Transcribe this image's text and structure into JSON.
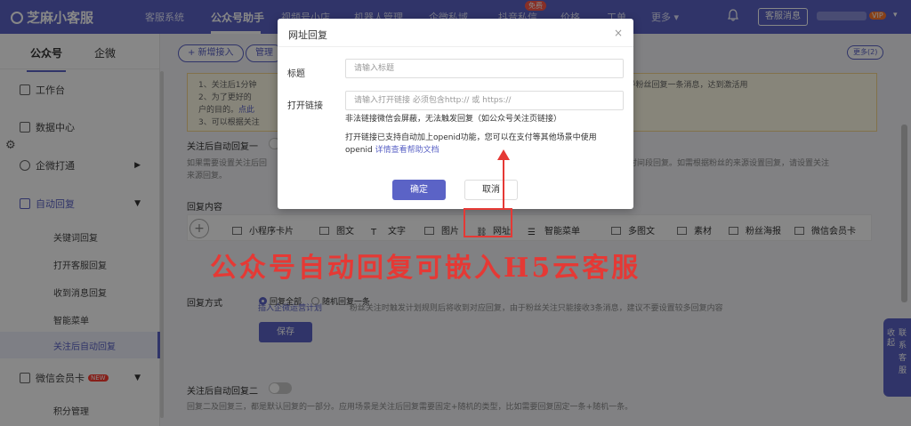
{
  "app": {
    "name": "芝麻小客服"
  },
  "topnav": {
    "items": [
      "客服系统",
      "公众号助手",
      "视频号小店",
      "机器人管理",
      "企微私域",
      "抖音私信",
      "价格",
      "工单",
      "更多"
    ],
    "active": "公众号助手",
    "free_badge": "免费",
    "kf_message_btn": "客服消息",
    "vip_badge": "VIP"
  },
  "sidebar": {
    "tabs": [
      "公众号",
      "企微"
    ],
    "items": {
      "workbench": "工作台",
      "data_center": "数据中心",
      "wecom_link": "企微打通",
      "auto_reply": "自动回复",
      "keyword_reply": "关键词回复",
      "open_kf_reply": "打开客服回复",
      "received_reply": "收到消息回复",
      "smart_menu": "智能菜单",
      "follow_reply": "关注后自动回复",
      "member_card": "微信会员卡",
      "new_badge": "NEW",
      "points": "积分管理"
    }
  },
  "content": {
    "new_access_btn": "+ 新增接入",
    "manage_btn": "管理",
    "more_btn": "更多(2)",
    "notice": {
      "line1": "1、关注后1分钟",
      "line1_tail": "会话的粉丝发送一条消息，引导粉丝回复一条消息，达到激活用",
      "line2": "2、为了更好的",
      "line2b": "户的目的。",
      "line2c": "点此",
      "line3": "3、可以根据关注"
    },
    "follow1_label": "关注后自动回复一",
    "follow1_desc1_a": "如果需要设置关注后回",
    "follow1_desc1_b": "设置按时间段回复。如需根据粉丝的来源设置回复，请设置关注",
    "follow1_desc2": "来源回复。",
    "reply_content_label": "回复内容",
    "toolbar": [
      "小程序卡片",
      "图文",
      "文字",
      "图片",
      "网址",
      "智能菜单",
      "多图文",
      "素材",
      "粉丝海报",
      "微信会员卡"
    ],
    "hint_link": "插入企微运营计划",
    "hint_text": "粉丝关注时触发计划规则后将收到对应回复，由于粉丝关注只能接收3条消息，建议不要设置较多回复内容",
    "reply_mode_label": "回复方式",
    "reply_mode_options": [
      "回复全部",
      "随机回复一条"
    ],
    "save_btn": "保存",
    "follow2_label": "关注后自动回复二",
    "follow2_desc": "回复二及回复三，都是默认回复的一部分。应用场景是关注后回复需要固定+随机的类型，比如需要回复固定一条+随机一条。"
  },
  "float_cs": {
    "text": "联系客服",
    "collapse": "收起"
  },
  "modal": {
    "title": "网址回复",
    "close": "×",
    "title_label": "标题",
    "title_placeholder": "请输入标题",
    "link_label": "打开链接",
    "link_placeholder": "请输入打开链接 必须包含http:// 或 https://",
    "note1": "非法链接微信会屏蔽，无法触发回复（如公众号关注页链接）",
    "note2": "打开链接已支持自动加上openid功能，您可以在支付等其他场景中使用",
    "note3": "openid",
    "help_link": "详情查看帮助文档",
    "ok_btn": "确定",
    "cancel_btn": "取消"
  },
  "annotation": {
    "caption": "公众号自动回复可嵌入H5云客服"
  },
  "colors": {
    "primary": "#5b63c6",
    "annotation": "#e53935"
  }
}
